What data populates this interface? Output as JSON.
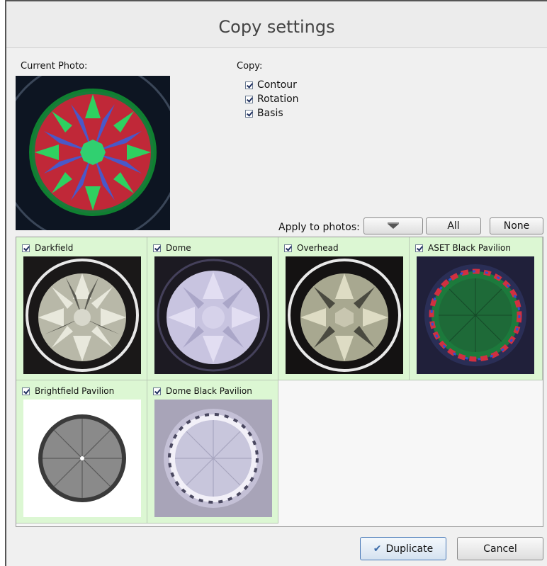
{
  "dialog": {
    "title": "Copy settings"
  },
  "current_photo": {
    "label": "Current Photo:"
  },
  "copy": {
    "label": "Copy:",
    "options": [
      {
        "label": "Contour",
        "checked": true
      },
      {
        "label": "Rotation",
        "checked": true
      },
      {
        "label": "Basis",
        "checked": true
      }
    ]
  },
  "apply": {
    "label": "Apply to photos:",
    "all_label": "All",
    "none_label": "None"
  },
  "photos": [
    {
      "label": "Darkfield",
      "checked": true
    },
    {
      "label": "Dome",
      "checked": true
    },
    {
      "label": "Overhead",
      "checked": true
    },
    {
      "label": "ASET Black Pavilion",
      "checked": true
    },
    {
      "label": "Brightfield Pavilion",
      "checked": true
    },
    {
      "label": "Dome Black Pavilion",
      "checked": true
    }
  ],
  "footer": {
    "duplicate_label": "Duplicate",
    "cancel_label": "Cancel"
  },
  "colors": {
    "cell_bg": "#dcf7d3",
    "accent": "#4a7ab8"
  }
}
